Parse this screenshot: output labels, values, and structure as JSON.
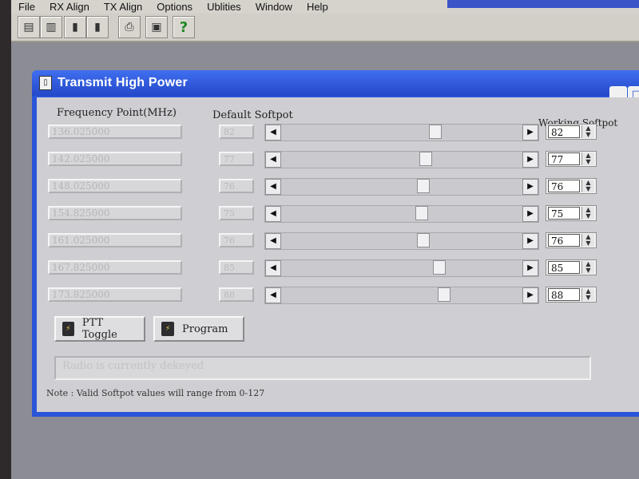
{
  "menu": [
    "File",
    "RX Align",
    "TX Align",
    "Options",
    "Ublities",
    "Window",
    "Help"
  ],
  "toolbar": {
    "buttons": [
      "open-file-icon",
      "save-file-icon",
      "radio-icon",
      "radio-write-icon",
      "print-icon",
      "monitor-icon",
      "help-icon"
    ],
    "help_label": "?"
  },
  "window": {
    "title": "Transmit High Power",
    "icon": "document-icon",
    "minimize_label": "_",
    "restore_label": "□"
  },
  "headers": {
    "frequency": "Frequency Point(MHz)",
    "default": "Default Softpot",
    "working": "Working Softpot"
  },
  "rows": [
    {
      "freq": "136.025000",
      "default": "82",
      "working": "82",
      "slider_fraction": 0.65
    },
    {
      "freq": "142.025000",
      "default": "77",
      "working": "77",
      "slider_fraction": 0.61
    },
    {
      "freq": "148.025000",
      "default": "76",
      "working": "76",
      "slider_fraction": 0.6
    },
    {
      "freq": "154.825000",
      "default": "75",
      "working": "75",
      "slider_fraction": 0.59
    },
    {
      "freq": "161.025000",
      "default": "76",
      "working": "76",
      "slider_fraction": 0.6
    },
    {
      "freq": "167.825000",
      "default": "85",
      "working": "85",
      "slider_fraction": 0.67
    },
    {
      "freq": "173.825000",
      "default": "88",
      "working": "88",
      "slider_fraction": 0.69
    }
  ],
  "buttons": {
    "ptt": "PTT Toggle",
    "program": "Program"
  },
  "status": "Radio is currently dekeyed",
  "note": "Note : Valid Softpot values will range from 0-127"
}
